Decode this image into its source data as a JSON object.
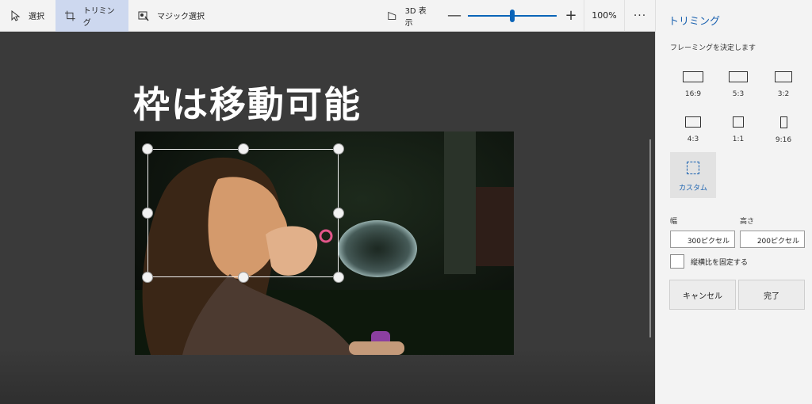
{
  "toolbar": {
    "select_label": "選択",
    "crop_label": "トリミング",
    "magic_select_label": "マジック選択",
    "view3d_label": "3D 表示",
    "zoom_minus": "—",
    "zoom_plus": "+",
    "zoom_level": "100%",
    "more": "···",
    "zoom_slider_fraction": 0.5
  },
  "canvas": {
    "heading": "枠は移動可能"
  },
  "panel": {
    "title": "トリミング",
    "subtitle": "フレーミングを決定します",
    "ratios": [
      "16:9",
      "5:3",
      "3:2",
      "4:3",
      "1:1",
      "9:16"
    ],
    "custom_label": "カスタム",
    "width_label": "幅",
    "height_label": "高さ",
    "width_value": "300ピクセル",
    "height_value": "200ピクセル",
    "lock_aspect_label": "縦横比を固定する",
    "cancel_label": "キャンセル",
    "done_label": "完了"
  },
  "colors": {
    "accent": "#0a64b8",
    "active_tool_bg": "#cdd8ef",
    "canvas_bg": "#3a3a3a",
    "panel_bg": "#f3f3f3"
  },
  "icons": [
    "select-cursor-icon",
    "crop-icon",
    "magic-select-icon",
    "view-3d-icon"
  ]
}
